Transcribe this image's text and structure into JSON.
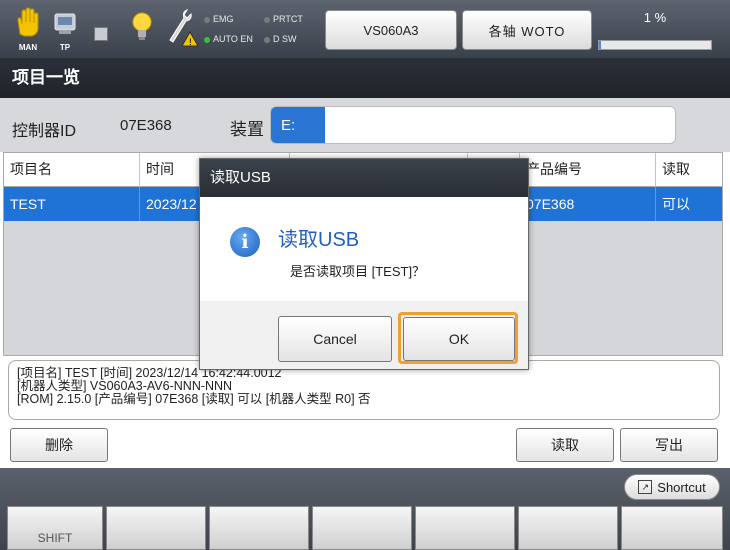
{
  "status_bar": {
    "man_label": "MAN",
    "tp_label": "TP",
    "leds": [
      {
        "label": "EMG",
        "color": "#7a7a7a"
      },
      {
        "label": "PRTCT",
        "color": "#7a7a7a"
      },
      {
        "label": "AUTO EN",
        "color": "#35c23a"
      },
      {
        "label": "D SW",
        "color": "#7a7a7a"
      }
    ],
    "robot_button": "VS060A3",
    "axis_button": "各轴 WOTO",
    "speed_percent": "1 %",
    "speed_fraction": 0.01
  },
  "title": "项目一览",
  "controller": {
    "id_label": "控制器ID",
    "id_value": "07E368",
    "device_label": "装置",
    "device_value": "E:"
  },
  "table": {
    "headers": [
      "项目名",
      "时间",
      "",
      "",
      "产品编号",
      "读取"
    ],
    "selected_row": {
      "name": "TEST",
      "time": "2023/12",
      "product": "07E368",
      "readable": "可以"
    }
  },
  "info": {
    "line1": "[项目名] TEST [时间] 2023/12/14 16:42:44.0012",
    "line2": "[机器人类型] VS060A3-AV6-NNN-NNN",
    "line3": "[ROM] 2.15.0 [产品编号] 07E368 [读取] 可以 [机器人类型 R0] 否"
  },
  "actions": {
    "delete": "删除",
    "read": "读取",
    "write": "写出"
  },
  "shortcut": "Shortcut",
  "fkeys": [
    "SHIFT",
    "",
    "",
    "",
    "",
    "",
    ""
  ],
  "dialog": {
    "title": "读取USB",
    "heading": "读取USB",
    "message": "是否读取项目 [TEST]？",
    "cancel": "Cancel",
    "ok": "OK",
    "icon_letter": "i"
  }
}
